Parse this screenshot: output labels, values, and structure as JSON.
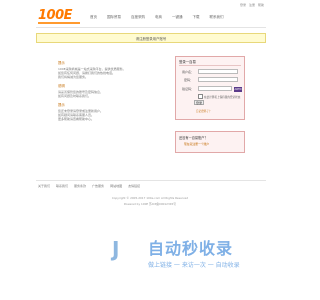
{
  "header": {
    "logo_text": "100E",
    "nav": [
      "首页",
      "国际贸易",
      "百度采购",
      "电商",
      "一键通",
      "下载",
      "联系我们"
    ],
    "top_links": [
      "登录",
      "注册",
      "帮助"
    ]
  },
  "banner": {
    "text": "请注册登录用户账号"
  },
  "left": {
    "section1_title": "提示",
    "section1_lines": [
      "100E采购商城是一站式采购平台，提供优质服务。",
      "如您有任何问题，请拨打我们的热线电话。",
      "我们将竭诚为您服务。"
    ],
    "section2_title": "说明",
    "section2_lines": [
      "请妥善保管您的账号及密码信息，",
      "如有问题及时联系我们。"
    ],
    "section3_title": "提示",
    "section3_lines": [
      "您还未登录请登录或注册新用户。",
      "如有疑问请联系客服人员。",
      "更多帮助请查看帮助中心。"
    ]
  },
  "login": {
    "header": "登录一百易",
    "username_label": "用户名：",
    "password_label": "密码：",
    "captcha_label": "验证码：",
    "captcha_value": "ARTN",
    "remember_label": "在此计算机上保持我的登录状态",
    "login_button": "登录",
    "forgot_link": "忘记密码了？"
  },
  "register": {
    "prompt": "还没有一百易账户？",
    "link": "现在就注册一个账户"
  },
  "footer": {
    "links": [
      "关于我们",
      "联系我们",
      "服务条款",
      "广告服务",
      "网站地图",
      "友情链接"
    ],
    "copyright": "Copyright © 2005-2017 100e.com All Rights Reserved",
    "icp": "Powered by 100E 苏ICP备09012345号"
  },
  "watermark": {
    "brand": "自动秒收录",
    "slogan": "做上链接 一 来访一次 一 自动收录"
  }
}
